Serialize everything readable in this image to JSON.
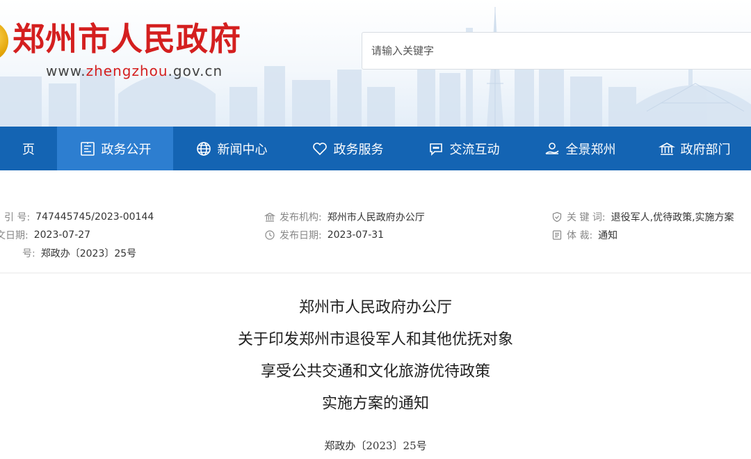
{
  "header": {
    "title": "郑州市人民政府",
    "url_prefix": "www.",
    "url_highlight": "zhengzhou",
    "url_suffix": ".gov.cn",
    "search_placeholder": "请输入关键字"
  },
  "nav": {
    "items": [
      {
        "label": "页",
        "icon": ""
      },
      {
        "label": "政务公开",
        "icon": "document-board-icon"
      },
      {
        "label": "新闻中心",
        "icon": "globe-icon"
      },
      {
        "label": "政务服务",
        "icon": "heart-icon"
      },
      {
        "label": "交流互动",
        "icon": "chat-bubble-icon"
      },
      {
        "label": "全景郑州",
        "icon": "hand-cloud-icon"
      },
      {
        "label": "政府部门",
        "icon": "government-building-icon"
      }
    ],
    "active_index": 1
  },
  "meta": {
    "index_label": "引  号:",
    "index_value": "747445745/2023-00144",
    "date_label": "文日期:",
    "date_value": "2023-07-27",
    "docno_label": "号:",
    "docno_value": "郑政办〔2023〕25号",
    "publisher_label": "发布机构:",
    "publisher_value": "郑州市人民政府办公厅",
    "pubdate_label": "发布日期:",
    "pubdate_value": "2023-07-31",
    "keywords_label": "关  键  词:",
    "keywords_value": "退役军人,优待政策,实施方案",
    "genre_label": "体      裁:",
    "genre_value": "通知"
  },
  "document": {
    "title_lines": [
      "郑州市人民政府办公厅",
      "关于印发郑州市退役军人和其他优抚对象",
      "享受公共交通和文化旅游优待政策",
      "实施方案的通知"
    ],
    "number": "郑政办〔2023〕25号"
  },
  "colors": {
    "brand_red": "#d41f1f",
    "nav_blue": "#1464b3",
    "nav_active": "#2d7ed0"
  }
}
